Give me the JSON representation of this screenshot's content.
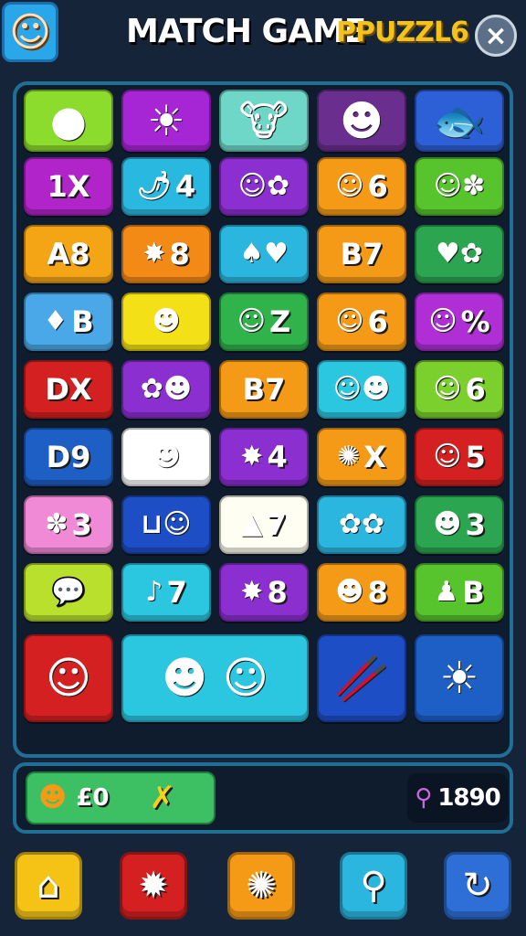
{
  "header": {
    "title": "MATCH GAME",
    "subtitle": "PPUZZL6",
    "close_icon": "×",
    "avatar_icon": "☺"
  },
  "tiles": [
    {
      "g": "●",
      "t": "",
      "bg": "#8bdc2c",
      "icon": "green-orb-icon"
    },
    {
      "g": "☀",
      "t": "",
      "bg": "#a626d6",
      "icon": "sun-face-icon"
    },
    {
      "g": "🐮",
      "t": "",
      "bg": "#6fd7c8",
      "icon": "cow-face-icon"
    },
    {
      "g": "☻",
      "t": "",
      "bg": "#6a2e8f",
      "icon": "red-face-icon"
    },
    {
      "g": "🐟",
      "t": "",
      "bg": "#2d5fd6",
      "icon": "purple-fish-icon"
    },
    {
      "g": "",
      "t": "1X",
      "bg": "#b024c9",
      "icon": "text-tile"
    },
    {
      "g": "🌶",
      "t": "4",
      "bg": "#29b8e0",
      "icon": "green-pepper-icon"
    },
    {
      "g": "☺✿",
      "t": "",
      "bg": "#8b2fd0",
      "icon": "creatures-icon"
    },
    {
      "g": "☺",
      "t": "6",
      "bg": "#f49a16",
      "icon": "blue-bird-icon"
    },
    {
      "g": "☺✽",
      "t": "",
      "bg": "#57c32d",
      "icon": "orange-face-flower-icon"
    },
    {
      "g": "",
      "t": "A8",
      "bg": "#f4a516",
      "icon": "text-tile"
    },
    {
      "g": "✸",
      "t": "8",
      "bg": "#f48a16",
      "icon": "red-splat-icon"
    },
    {
      "g": "♠♥",
      "t": "",
      "bg": "#2bb6e0",
      "icon": "shape-heart-icon"
    },
    {
      "g": "",
      "t": "B7",
      "bg": "#f49a16",
      "icon": "text-tile"
    },
    {
      "g": "♥✿",
      "t": "",
      "bg": "#2ba550",
      "icon": "heart-flower-icon"
    },
    {
      "g": "♦",
      "t": "B",
      "bg": "#4aa8e8",
      "icon": "purple-crystal-icon"
    },
    {
      "g": "☻",
      "t": "",
      "bg": "#f4e016",
      "icon": "orange-creature-icon"
    },
    {
      "g": "☺",
      "t": "Z",
      "bg": "#2fb34a",
      "icon": "green-face-icon"
    },
    {
      "g": "☺",
      "t": "6",
      "bg": "#f49a16",
      "icon": "ghost-face-icon"
    },
    {
      "g": "☺",
      "t": "%",
      "bg": "#b02ed6",
      "icon": "blue-face-icon"
    },
    {
      "g": "",
      "t": "DX",
      "bg": "#d42020",
      "icon": "text-tile"
    },
    {
      "g": "✿☻",
      "t": "",
      "bg": "#8b2fd0",
      "icon": "purple-creatures-icon"
    },
    {
      "g": "",
      "t": "B7",
      "bg": "#f49a16",
      "icon": "text-tile"
    },
    {
      "g": "☺☻",
      "t": "",
      "bg": "#2bc6e0",
      "icon": "frog-bear-icon"
    },
    {
      "g": "☺",
      "t": "6",
      "bg": "#7cd02d",
      "icon": "chick-face-icon"
    },
    {
      "g": "",
      "t": "D9",
      "bg": "#1e5fc6",
      "icon": "text-tile"
    },
    {
      "g": "☻",
      "t": "",
      "bg": "#ffffff",
      "icon": "red-bird-icon"
    },
    {
      "g": "✸",
      "t": "4",
      "bg": "#8b2fd0",
      "icon": "gear-flower-icon"
    },
    {
      "g": "✺",
      "t": "X",
      "bg": "#f49a16",
      "icon": "red-flower-icon"
    },
    {
      "g": "☺",
      "t": "5",
      "bg": "#d42020",
      "icon": "yellow-face-icon"
    },
    {
      "g": "✽",
      "t": "3",
      "bg": "#f08ad6",
      "icon": "pink-flower-icon"
    },
    {
      "g": "⊔☺",
      "t": "",
      "bg": "#1e4ec6",
      "icon": "letter-u-face-icon"
    },
    {
      "g": "▲",
      "t": "7",
      "bg": "#fffef2",
      "icon": "orange-cone-icon"
    },
    {
      "g": "✿✿",
      "t": "",
      "bg": "#2bb6e0",
      "icon": "flowers-icon"
    },
    {
      "g": "☻",
      "t": "3",
      "bg": "#2ba550",
      "icon": "red-fish-icon"
    },
    {
      "g": "💬",
      "t": "",
      "bg": "#b8e02c",
      "icon": "speech-bubble-icon"
    },
    {
      "g": "♪",
      "t": "7",
      "bg": "#2bc6e0",
      "icon": "green-note-icon"
    },
    {
      "g": "✸",
      "t": "8",
      "bg": "#8b2fd0",
      "icon": "yellow-star-icon"
    },
    {
      "g": "☻",
      "t": "8",
      "bg": "#f49a16",
      "icon": "purple-creature-icon"
    },
    {
      "g": "♟",
      "t": "B",
      "bg": "#57c32d",
      "icon": "red-figure-icon"
    }
  ],
  "bottom_tiles": [
    {
      "g": "☺",
      "bg": "#d42020",
      "icon": "clock-face-icon",
      "w": 1
    },
    {
      "g": "☻ ☺",
      "bg": "#2bc6e0",
      "icon": "mushroom-monster-icon",
      "w": 2
    },
    {
      "g": "🥢",
      "bg": "#1e4ec6",
      "icon": "box-chopsticks-icon",
      "w": 1
    },
    {
      "g": "☀",
      "bg": "#1e5fc6",
      "icon": "sun-face-icon",
      "w": 1
    }
  ],
  "status": {
    "pill_icon": "☻",
    "pill_count": "£0",
    "hint_icon": "✗",
    "score_icon": "⚲",
    "score_value": "1890"
  },
  "nav": [
    {
      "icon": "home-icon",
      "g": "⌂",
      "bg": "#f4c316"
    },
    {
      "icon": "gear-icon",
      "g": "✹",
      "bg": "#d42020"
    },
    {
      "icon": "star-gear-icon",
      "g": "✺",
      "bg": "#f49a16"
    },
    {
      "icon": "magnifier-icon",
      "g": "⚲",
      "bg": "#2bb6e0"
    },
    {
      "icon": "refresh-icon",
      "g": "↻",
      "bg": "#2d6fd6"
    }
  ]
}
